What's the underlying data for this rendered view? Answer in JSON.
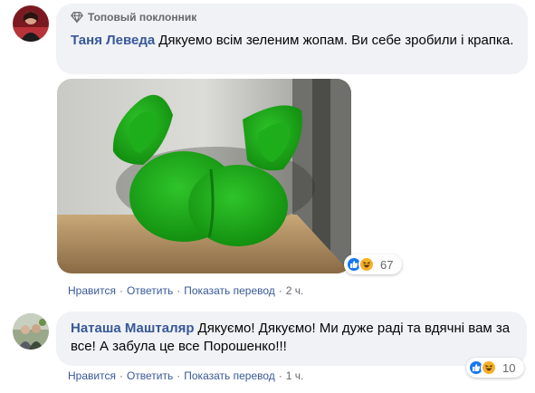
{
  "comments": [
    {
      "badge": "Топовый поклонник",
      "author": "Таня Леведа",
      "text": "Дякуемо всім зеленим жопам. Ви себе зробили і крапка.",
      "reaction_count": "67",
      "actions": {
        "like": "Нравится",
        "reply": "Ответить",
        "translate": "Показать перевод",
        "time": "2 ч."
      }
    },
    {
      "author": "Наташа Машталяр",
      "text": "Дякуємо! Дякуємо! Ми дуже раді та вдячні вам за все! А забула це все Порошенко!!!",
      "reaction_count": "10",
      "actions": {
        "like": "Нравится",
        "reply": "Ответить",
        "translate": "Показать перевод",
        "time": "1 ч."
      }
    }
  ],
  "icons": {
    "badge": "diamond-icon",
    "reaction_like": "like-reaction-icon",
    "reaction_haha": "haha-reaction-icon"
  },
  "colors": {
    "author_link": "#385898",
    "bubble_bg": "#f0f2f5",
    "meta_gray": "#65676b",
    "like_blue": "#1877f2",
    "haha_yellow": "#f7b125"
  }
}
